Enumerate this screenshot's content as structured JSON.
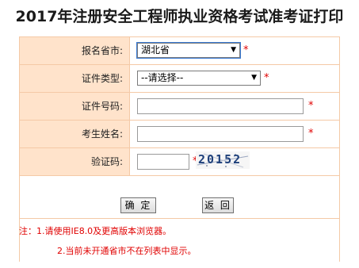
{
  "page": {
    "title": "2017年注册安全工程师执业资格考试准考证打印"
  },
  "form": {
    "province": {
      "label": "报名省市:",
      "value": "湖北省",
      "required_mark": "*"
    },
    "id_type": {
      "label": "证件类型:",
      "value": "--请选择--",
      "required_mark": "*"
    },
    "id_number": {
      "label": "证件号码:",
      "value": "",
      "required_mark": "*"
    },
    "name": {
      "label": "考生姓名:",
      "value": "",
      "required_mark": "*"
    },
    "captcha": {
      "label": "验证码:",
      "value": "",
      "required_mark": "*",
      "image_text": "20152"
    }
  },
  "buttons": {
    "confirm": "确 定",
    "back": "返 回"
  },
  "notes": {
    "line1": "注：1.请使用IE8.0及更高版本浏览器。",
    "line2": "2.当前未开通省市不在列表中显示。"
  },
  "colors": {
    "label_bg": "#ffe3cb",
    "border": "#f4c9a6",
    "required": "#e00000"
  }
}
